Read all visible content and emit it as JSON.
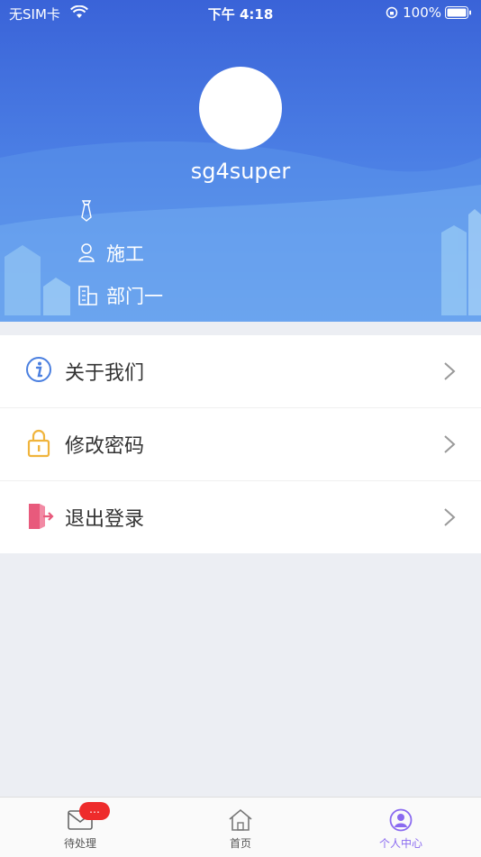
{
  "status_bar": {
    "carrier": "无SIM卡",
    "time": "下午 4:18",
    "battery": "100%"
  },
  "profile": {
    "username": "sg4super",
    "role": "施工",
    "department": "部门一"
  },
  "menu": {
    "items": [
      {
        "label": "关于我们",
        "icon": "info-icon"
      },
      {
        "label": "修改密码",
        "icon": "lock-icon"
      },
      {
        "label": "退出登录",
        "icon": "logout-icon"
      }
    ]
  },
  "tabbar": {
    "tabs": [
      {
        "label": "待处理",
        "badge": "…"
      },
      {
        "label": "首页"
      },
      {
        "label": "个人中心"
      }
    ]
  },
  "colors": {
    "header": "#3a63d8",
    "active_tab": "#8a6af0",
    "badge": "#ee2b2b",
    "lock": "#f0b43c",
    "logout": "#e85a7c",
    "info": "#4a7fe0"
  }
}
